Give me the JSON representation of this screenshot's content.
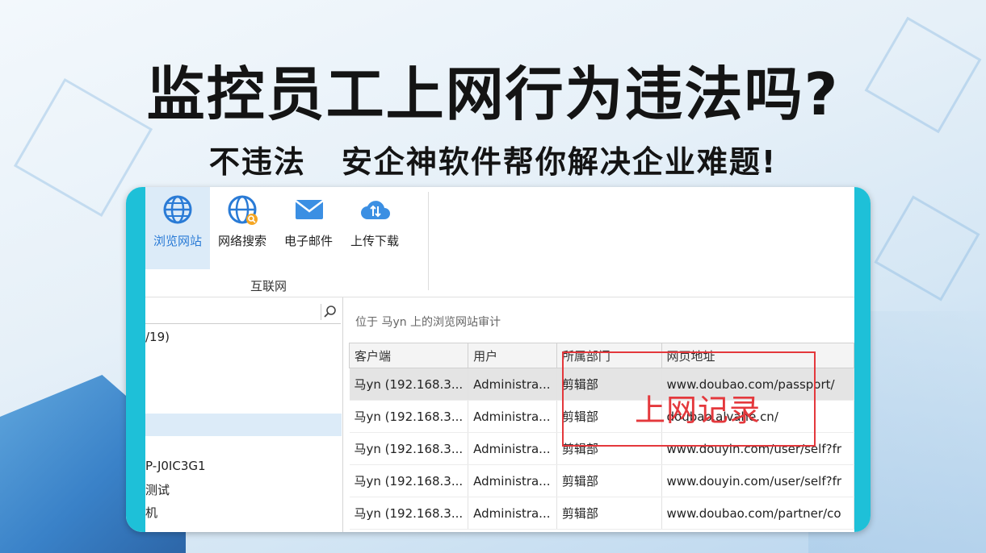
{
  "headline": "监控员工上网行为违法吗?",
  "subheadline": [
    "不违法",
    "安企神软件帮你解决企业难题!"
  ],
  "accent_color": "#1ec0d8",
  "highlight_color": "#e4383c",
  "ribbon": {
    "buttons": [
      {
        "label": "浏览网站",
        "icon": "globe-icon",
        "selected": true
      },
      {
        "label": "网络搜索",
        "icon": "globe-search-icon",
        "selected": false
      },
      {
        "label": "电子邮件",
        "icon": "mail-icon",
        "selected": false
      },
      {
        "label": "上传下载",
        "icon": "cloud-transfer-icon",
        "selected": false
      }
    ],
    "group_label": "互联网"
  },
  "left_panel": {
    "search_icon": "search-icon",
    "tree_items": [
      "/19)",
      "P-J0IC3G1",
      "测试",
      "机"
    ]
  },
  "main": {
    "breadcrumb": "位于 马yn 上的浏览网站审计",
    "columns": [
      "客户端",
      "用户",
      "所属部门",
      "网页地址"
    ],
    "rows": [
      [
        "马yn (192.168.3...",
        "Administra...",
        "剪辑部",
        "www.doubao.com/passport/"
      ],
      [
        "马yn (192.168.3...",
        "Administra...",
        "剪辑部",
        "doubao.alvahe.cn/"
      ],
      [
        "马yn (192.168.3...",
        "Administra...",
        "剪辑部",
        "www.douyin.com/user/self?fr"
      ],
      [
        "马yn (192.168.3...",
        "Administra...",
        "剪辑部",
        "www.douyin.com/user/self?fr"
      ],
      [
        "马yn (192.168.3...",
        "Administra...",
        "剪辑部",
        "www.doubao.com/partner/co"
      ]
    ]
  },
  "annotation": "上网记录"
}
